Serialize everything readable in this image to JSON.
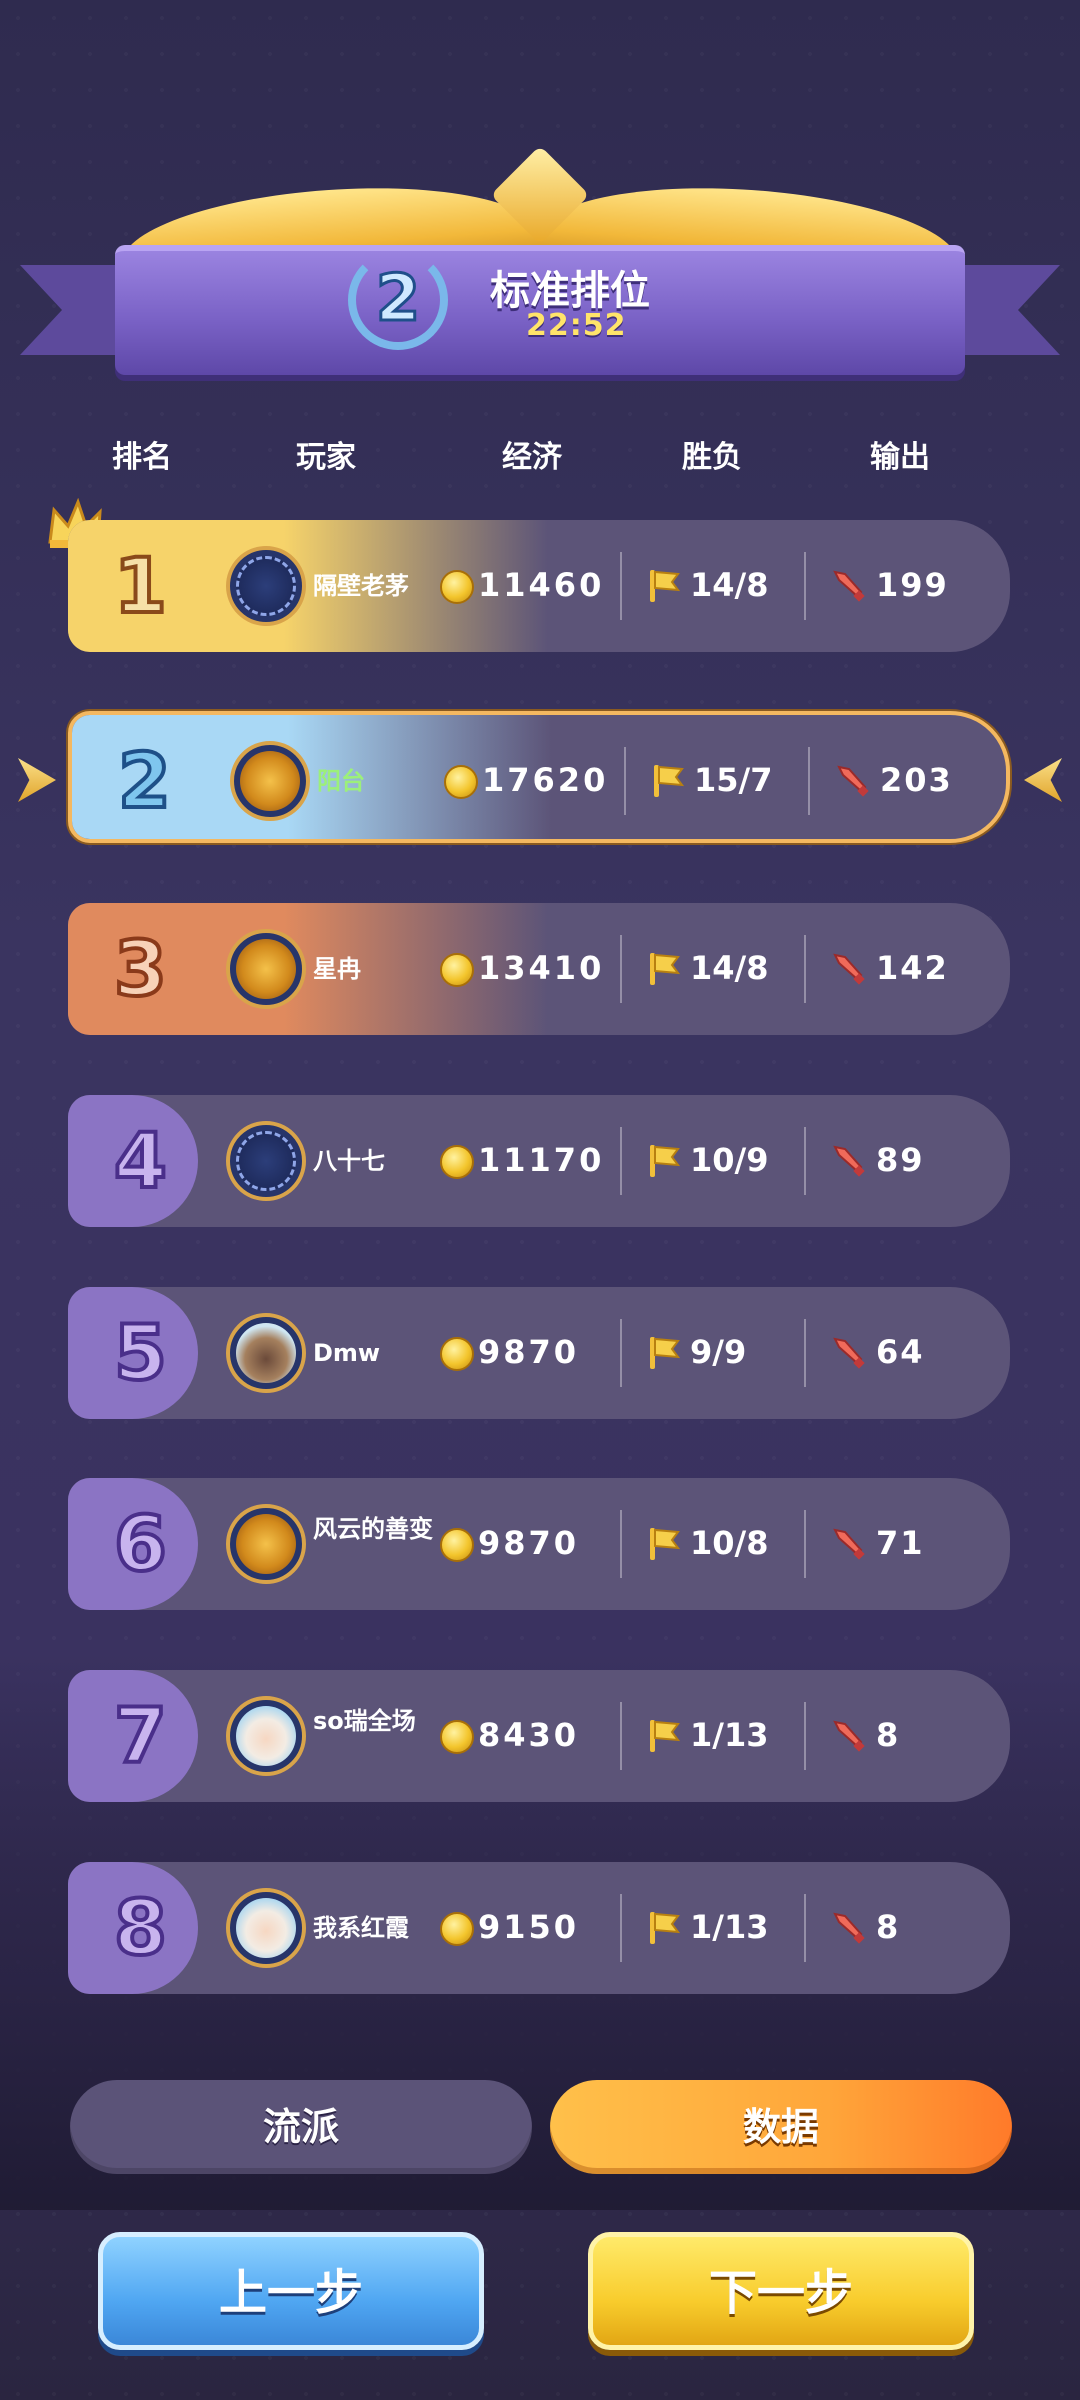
{
  "banner": {
    "rank": "2",
    "title": "标准排位",
    "time": "22:52"
  },
  "headers": {
    "rank": "排名",
    "player": "玩家",
    "economy": "经济",
    "winloss": "胜负",
    "damage": "输出"
  },
  "rows": [
    {
      "rank": "1",
      "name": "隔壁老茅",
      "economy": "11460",
      "winloss": "14/8",
      "damage": "199",
      "avatar_icon": "gear-loading-avatar-icon"
    },
    {
      "rank": "2",
      "name": "阳台",
      "economy": "17620",
      "winloss": "15/7",
      "damage": "203",
      "avatar_icon": "gold-emblem-avatar-icon"
    },
    {
      "rank": "3",
      "name": "星冉",
      "economy": "13410",
      "winloss": "14/8",
      "damage": "142",
      "avatar_icon": "gold-emblem-avatar-icon"
    },
    {
      "rank": "4",
      "name": "八十七",
      "economy": "11170",
      "winloss": "10/9",
      "damage": "89",
      "avatar_icon": "gear-loading-avatar-icon"
    },
    {
      "rank": "5",
      "name": "Dmw",
      "economy": "9870",
      "winloss": "9/9",
      "damage": "64",
      "avatar_icon": "raccoon-avatar-icon"
    },
    {
      "rank": "6",
      "name": "风云的善变",
      "economy": "9870",
      "winloss": "10/8",
      "damage": "71",
      "avatar_icon": "gold-emblem-avatar-icon"
    },
    {
      "rank": "7",
      "name": "so瑞全场",
      "economy": "8430",
      "winloss": "1/13",
      "damage": "8",
      "avatar_icon": "hooded-girl-avatar-icon"
    },
    {
      "rank": "8",
      "name": "我系红霞",
      "economy": "9150",
      "winloss": "1/13",
      "damage": "8",
      "avatar_icon": "white-hair-girl-avatar-icon"
    }
  ],
  "tabs": {
    "style": "流派",
    "data": "数据"
  },
  "buttons": {
    "prev": "上一步",
    "next": "下一步"
  },
  "colors": {
    "rank1": "#f6d36a",
    "rank2": "#a9d8f5",
    "rank3": "#e08a5e",
    "rank_other": "#8b74c4",
    "highlight_border": "#f4b860",
    "name_highlight": "#9cf07a"
  }
}
